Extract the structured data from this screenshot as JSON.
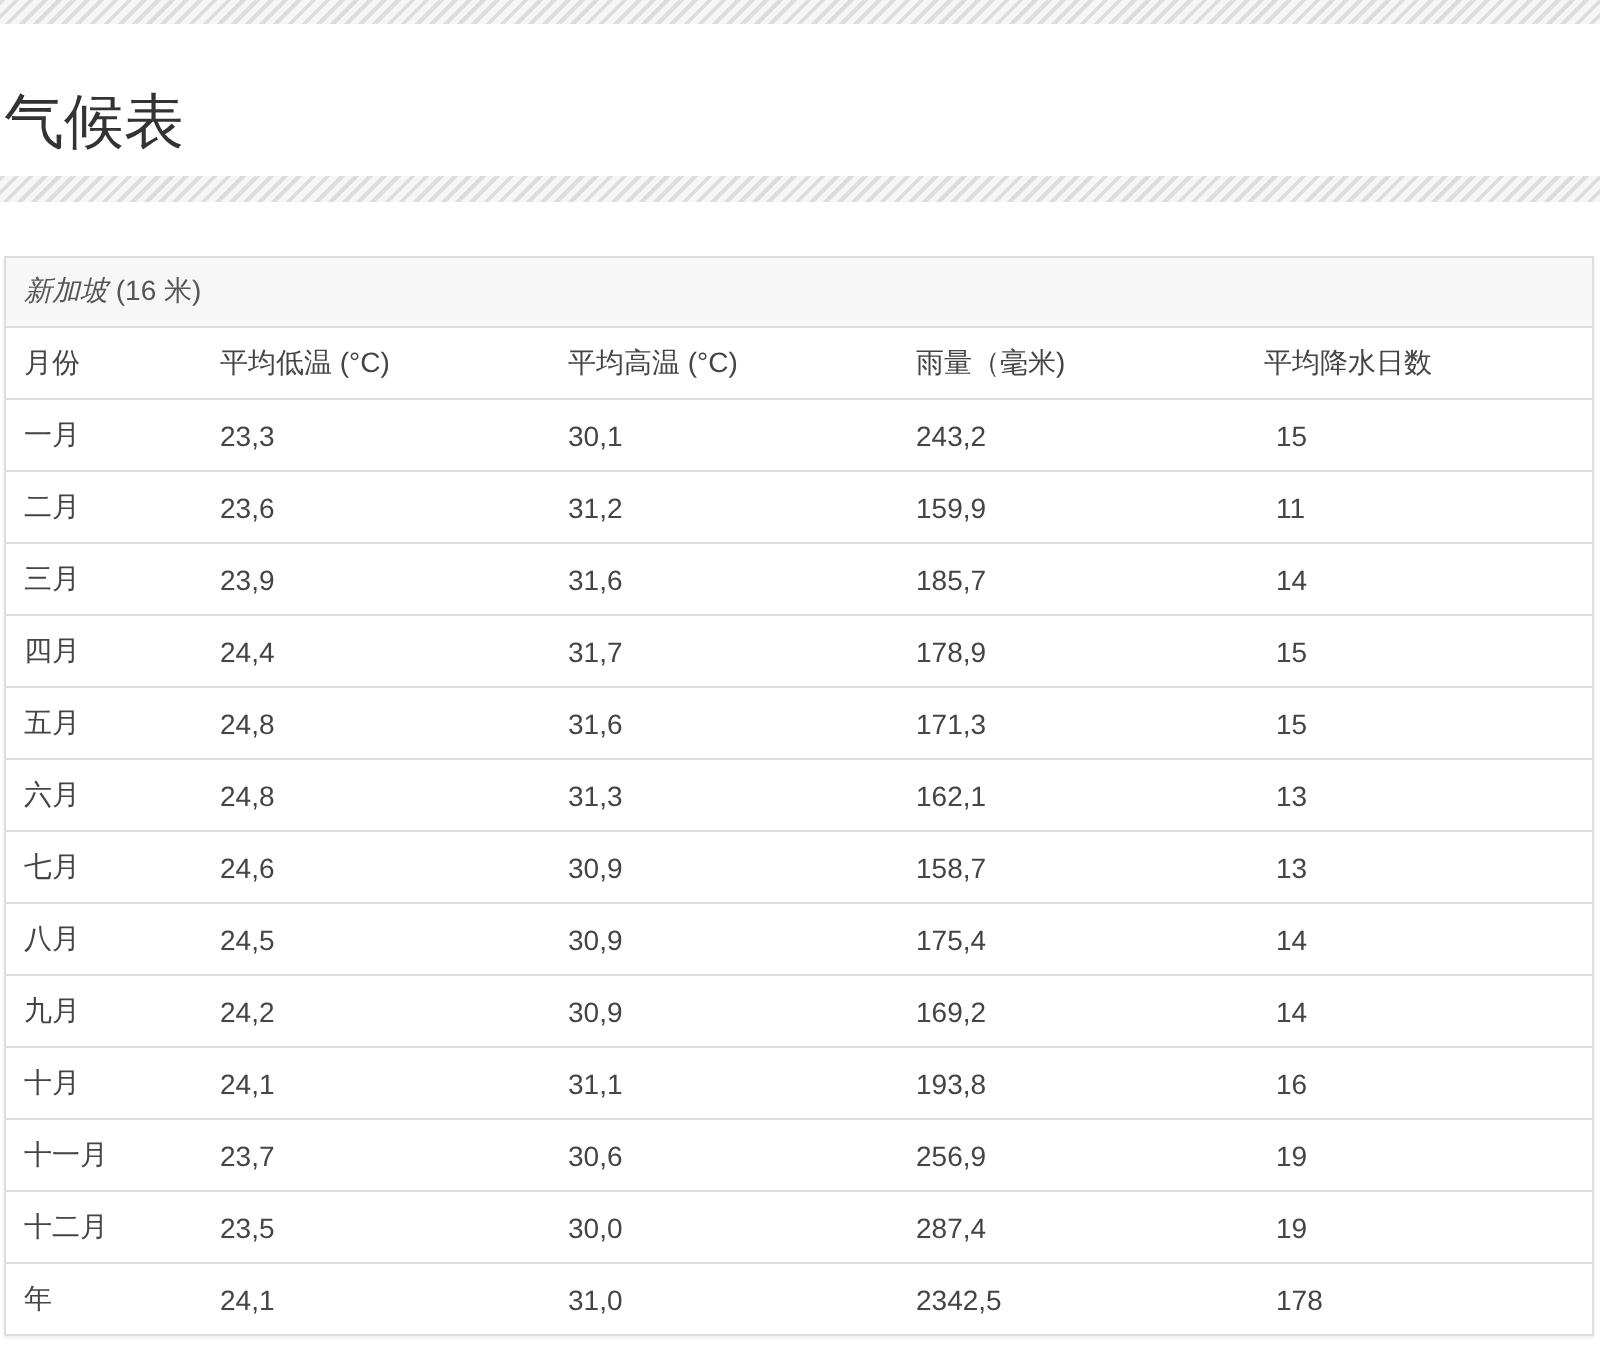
{
  "heading": "气候表",
  "table": {
    "caption": "*新加坡* (16 米)",
    "columns": [
      "月份",
      "平均低温 (°C)",
      "平均高温 (°C)",
      "雨量（毫米)",
      "平均降水日数"
    ],
    "rows": [
      [
        "一月",
        "23,3",
        "30,1",
        "243,2",
        "15"
      ],
      [
        "二月",
        "23,6",
        "31,2",
        "159,9",
        "11"
      ],
      [
        "三月",
        "23,9",
        "31,6",
        "185,7",
        "14"
      ],
      [
        "四月",
        "24,4",
        "31,7",
        "178,9",
        "15"
      ],
      [
        "五月",
        "24,8",
        "31,6",
        "171,3",
        "15"
      ],
      [
        "六月",
        "24,8",
        "31,3",
        "162,1",
        "13"
      ],
      [
        "七月",
        "24,6",
        "30,9",
        "158,7",
        "13"
      ],
      [
        "八月",
        "24,5",
        "30,9",
        "175,4",
        "14"
      ],
      [
        "九月",
        "24,2",
        "30,9",
        "169,2",
        "14"
      ],
      [
        "十月",
        "24,1",
        "31,1",
        "193,8",
        "16"
      ],
      [
        "十一月",
        "23,7",
        "30,6",
        "256,9",
        "19"
      ],
      [
        "十二月",
        "23,5",
        "30,0",
        "287,4",
        "19"
      ],
      [
        "年",
        "24,1",
        "31,0",
        "2342,5",
        "178"
      ]
    ]
  }
}
